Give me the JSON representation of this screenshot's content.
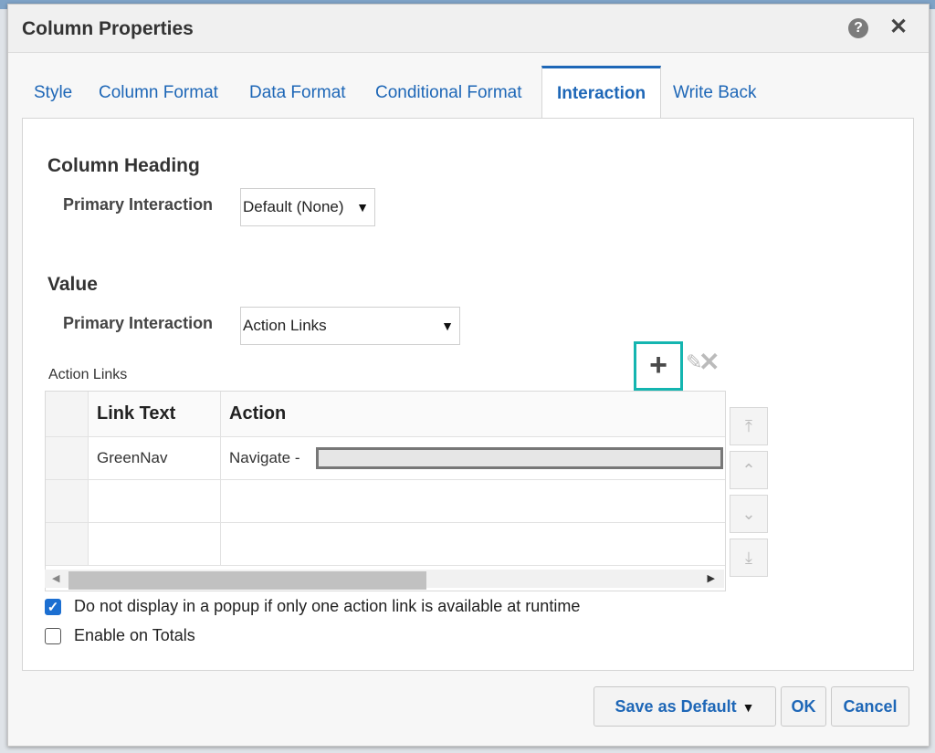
{
  "dialog": {
    "title": "Column Properties",
    "help_icon": "?",
    "close_icon": "✕"
  },
  "tabs": [
    {
      "label": "Style",
      "active": false
    },
    {
      "label": "Column Format",
      "active": false
    },
    {
      "label": "Data Format",
      "active": false
    },
    {
      "label": "Conditional Format",
      "active": false
    },
    {
      "label": "Interaction",
      "active": true
    },
    {
      "label": "Write Back",
      "active": false
    }
  ],
  "column_heading": {
    "title": "Column Heading",
    "primary_interaction_label": "Primary Interaction",
    "primary_interaction_value": "Default (None)"
  },
  "value": {
    "title": "Value",
    "primary_interaction_label": "Primary Interaction",
    "primary_interaction_value": "Action Links"
  },
  "action_links": {
    "label": "Action Links",
    "toolbar": {
      "add_icon": "+",
      "edit_icon": "✎",
      "delete_icon": "✕"
    },
    "columns": [
      "Link Text",
      "Action"
    ],
    "rows": [
      {
        "link_text": "GreenNav",
        "action": "Navigate -"
      },
      {
        "link_text": "",
        "action": ""
      },
      {
        "link_text": "",
        "action": ""
      }
    ],
    "mover_icons": [
      "⤒",
      "⌃",
      "⌄",
      "⤓"
    ]
  },
  "options": {
    "no_popup_label": "Do not display in a popup if only one action link is available at runtime",
    "no_popup_checked": true,
    "enable_totals_label": "Enable on Totals",
    "enable_totals_checked": false
  },
  "footer": {
    "save_default_label": "Save as Default",
    "ok_label": "OK",
    "cancel_label": "Cancel"
  },
  "colors": {
    "accent": "#1e67b7",
    "highlight": "#14b5b0",
    "checkbox": "#1c6fd1"
  }
}
